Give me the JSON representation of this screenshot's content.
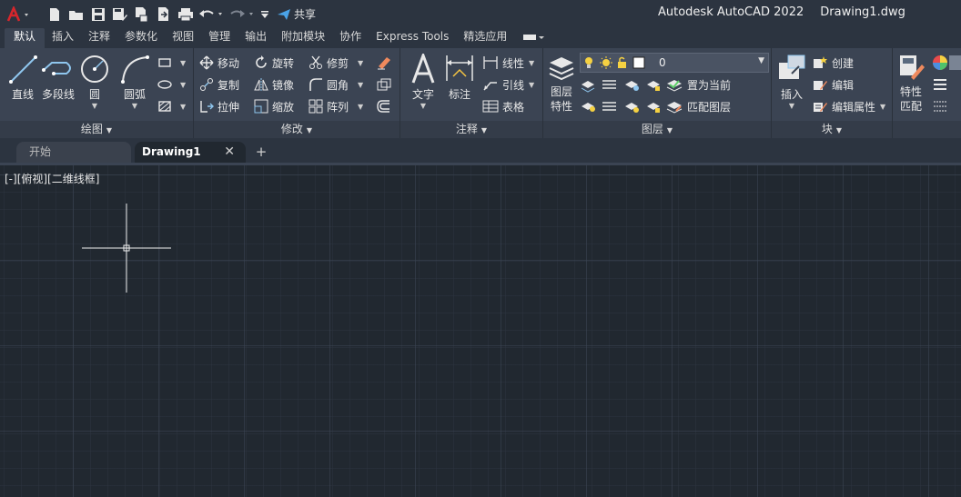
{
  "window": {
    "app_title": "Autodesk AutoCAD 2022",
    "file_name": "Drawing1.dwg"
  },
  "quick_access": {
    "share_label": "共享",
    "icons": [
      "autocad-logo-icon",
      "new-file-icon",
      "open-folder-icon",
      "save-icon",
      "save-as-icon",
      "publish-icon",
      "export-icon",
      "print-icon",
      "undo-icon",
      "redo-icon",
      "customize-icon",
      "share-icon"
    ]
  },
  "ribbon_tabs": [
    "默认",
    "插入",
    "注释",
    "参数化",
    "视图",
    "管理",
    "输出",
    "附加模块",
    "协作",
    "Express Tools",
    "精选应用"
  ],
  "active_tab": "默认",
  "panels": {
    "draw": {
      "title": "绘图",
      "big_buttons": [
        "直线",
        "多段线",
        "圆",
        "圆弧"
      ]
    },
    "modify": {
      "title": "修改",
      "buttons": [
        "移动",
        "旋转",
        "修剪",
        "复制",
        "镜像",
        "圆角",
        "拉伸",
        "缩放",
        "阵列"
      ]
    },
    "annotation": {
      "title": "注释",
      "big_buttons": [
        "文字",
        "标注"
      ],
      "buttons": [
        "线性",
        "引线",
        "表格"
      ]
    },
    "layers": {
      "title": "图层",
      "properties_line1": "图层",
      "properties_line2": "特性",
      "current_layer": "0",
      "buttons": [
        "置为当前",
        "匹配图层"
      ]
    },
    "block": {
      "title": "块",
      "big_button": "插入",
      "buttons": [
        "创建",
        "编辑",
        "编辑属性"
      ]
    },
    "properties": {
      "match_line1": "特性",
      "match_line2": "匹配"
    }
  },
  "doc_tabs": {
    "start": "开始",
    "drawing": "Drawing1",
    "close": "✕",
    "add": "+"
  },
  "viewport": {
    "label": "[-][俯视][二维线框]"
  },
  "colors": {
    "canvas_bg": "#212830",
    "ribbon_bg": "#3b4453",
    "titlebar_bg": "#2c3440",
    "logo_red": "#d6262c",
    "share_blue": "#4aa3e8"
  }
}
